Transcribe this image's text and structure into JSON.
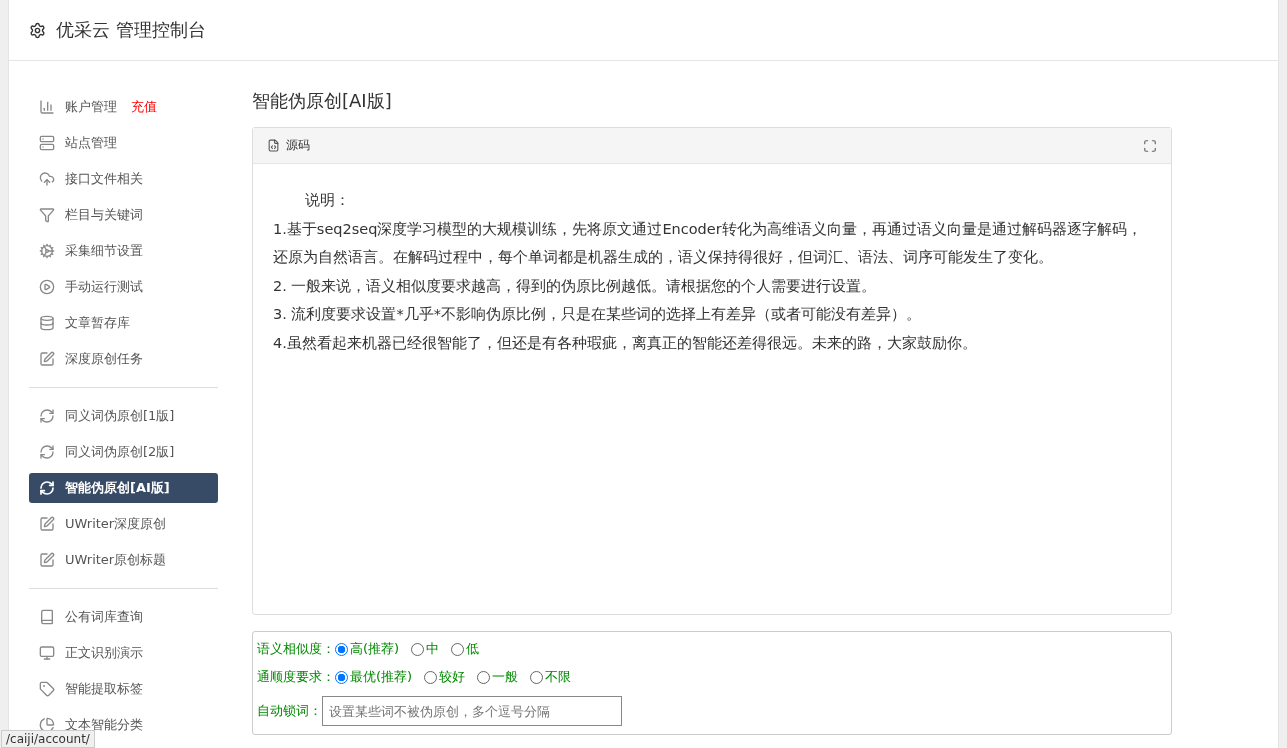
{
  "header": {
    "title": "优采云 管理控制台"
  },
  "sidebar": {
    "groups": [
      {
        "items": [
          {
            "label": "账户管理",
            "badge": "充值",
            "selected": false
          },
          {
            "label": "站点管理",
            "selected": false
          },
          {
            "label": "接口文件相关",
            "selected": false
          },
          {
            "label": "栏目与关键词",
            "selected": false
          },
          {
            "label": "采集细节设置",
            "selected": false
          },
          {
            "label": "手动运行测试",
            "selected": false
          },
          {
            "label": "文章暂存库",
            "selected": false
          },
          {
            "label": "深度原创任务",
            "selected": false
          }
        ]
      },
      {
        "items": [
          {
            "label": "同义词伪原创[1版]",
            "selected": false
          },
          {
            "label": "同义词伪原创[2版]",
            "selected": false
          },
          {
            "label": "智能伪原创[AI版]",
            "selected": true
          },
          {
            "label": "UWriter深度原创",
            "selected": false
          },
          {
            "label": "UWriter原创标题",
            "selected": false
          }
        ]
      },
      {
        "items": [
          {
            "label": "公有词库查询",
            "selected": false
          },
          {
            "label": "正文识别演示",
            "selected": false
          },
          {
            "label": "智能提取标签",
            "selected": false
          },
          {
            "label": "文本智能分类",
            "selected": false
          }
        ]
      }
    ]
  },
  "page_title": "智能伪原创[AI版]",
  "editor": {
    "toolbar_button": "源码",
    "paragraphs": [
      "说明：",
      "1.基于seq2seq深度学习模型的大规模训练，先将原文通过Encoder转化为高维语义向量，再通过语义向量是通过解码器逐字解码，还原为自然语言。在解码过程中，每个单词都是机器生成的，语义保持得很好，但词汇、语法、词序可能发生了变化。",
      "2. 一般来说，语义相似度要求越高，得到的伪原比例越低。请根据您的个人需要进行设置。",
      "3. 流利度要求设置*几乎*不影响伪原比例，只是在某些词的选择上有差异（或者可能没有差异）。",
      "4.虽然看起来机器已经很智能了，但还是有各种瑕疵，离真正的智能还差得很远。未来的路，大家鼓励你。"
    ]
  },
  "options": [
    {
      "label": "语义相似度：",
      "choices": [
        {
          "label": "高(推荐)",
          "selected": true
        },
        {
          "label": "中",
          "selected": false
        },
        {
          "label": "低",
          "selected": false
        }
      ]
    },
    {
      "label": "通顺度要求：",
      "choices": [
        {
          "label": "最优(推荐)",
          "selected": true
        },
        {
          "label": "较好",
          "selected": false
        },
        {
          "label": "一般",
          "selected": false
        },
        {
          "label": "不限",
          "selected": false
        }
      ]
    }
  ],
  "lock_words": {
    "label": "自动锁词：",
    "placeholder": "设置某些词不被伪原创，多个逗号分隔"
  },
  "status_url": "/caiji/account/"
}
